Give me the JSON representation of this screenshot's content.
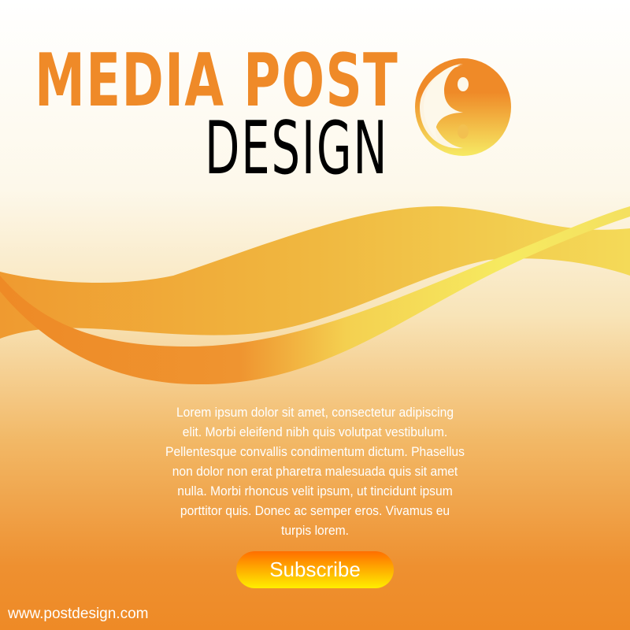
{
  "header": {
    "title_line1": "MEDIA POST",
    "title_line2": "DESIGN",
    "logo_icon": "yin-yang-icon"
  },
  "body": {
    "lines": [
      "Lorem ipsum dolor sit amet, consectetur adipiscing",
      "elit. Morbi eleifend nibh quis volutpat vestibulum.",
      "Pellentesque convallis condimentum dictum. Phasellus",
      "non dolor non erat pharetra malesuada quis sit amet",
      "nulla. Morbi rhoncus velit ipsum, ut tincidunt ipsum",
      "porttitor quis. Donec ac semper eros. Vivamus eu",
      "turpis lorem."
    ]
  },
  "cta": {
    "label": "Subscribe"
  },
  "footer": {
    "url": "www.postdesign.com"
  },
  "colors": {
    "accent": "#ef8a28",
    "yellow": "#f4e060"
  }
}
